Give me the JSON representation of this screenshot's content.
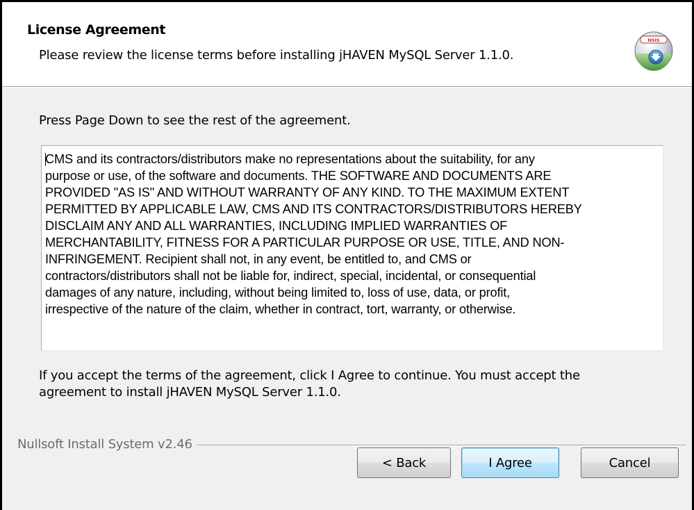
{
  "header": {
    "title": "License Agreement",
    "subtitle": "Please review the license terms before installing jHAVEN MySQL Server 1.1.0.",
    "icon": "installer-disk-icon"
  },
  "main": {
    "page_down_hint": "Press Page Down to see the rest of the agreement.",
    "license_text": "CMS and its contractors/distributors make no representations about the suitability, for any\npurpose or use, of the software and documents.  THE SOFTWARE AND DOCUMENTS ARE\nPROVIDED \"AS IS\" AND WITHOUT WARRANTY OF ANY KIND.  TO THE MAXIMUM EXTENT\nPERMITTED BY APPLICABLE LAW, CMS AND ITS CONTRACTORS/DISTRIBUTORS HEREBY\nDISCLAIM ANY AND ALL WARRANTIES, INCLUDING IMPLIED WARRANTIES OF\nMERCHANTABILITY, FITNESS FOR A PARTICULAR PURPOSE OR USE, TITLE, AND NON-\nINFRINGEMENT.  Recipient shall not, in any event, be entitled to, and CMS or\ncontractors/distributors shall not be liable for, indirect, special, incidental, or consequential\ndamages of any nature, including, without being limited to, loss of use, data, or profit,\nirrespective of the nature of the claim, whether in contract, tort, warranty, or otherwise.",
    "accept_text": "If you accept the terms of the agreement, click I Agree to continue. You must accept the\nagreement to install jHAVEN MySQL Server 1.1.0."
  },
  "footer": {
    "branding": "Nullsoft Install System v2.46",
    "buttons": {
      "back": "< Back",
      "agree": "I Agree",
      "cancel": "Cancel"
    }
  },
  "colors": {
    "window_bg": "#f0f0f0",
    "header_bg": "#ffffff",
    "default_button_border": "#3c7fb1"
  }
}
